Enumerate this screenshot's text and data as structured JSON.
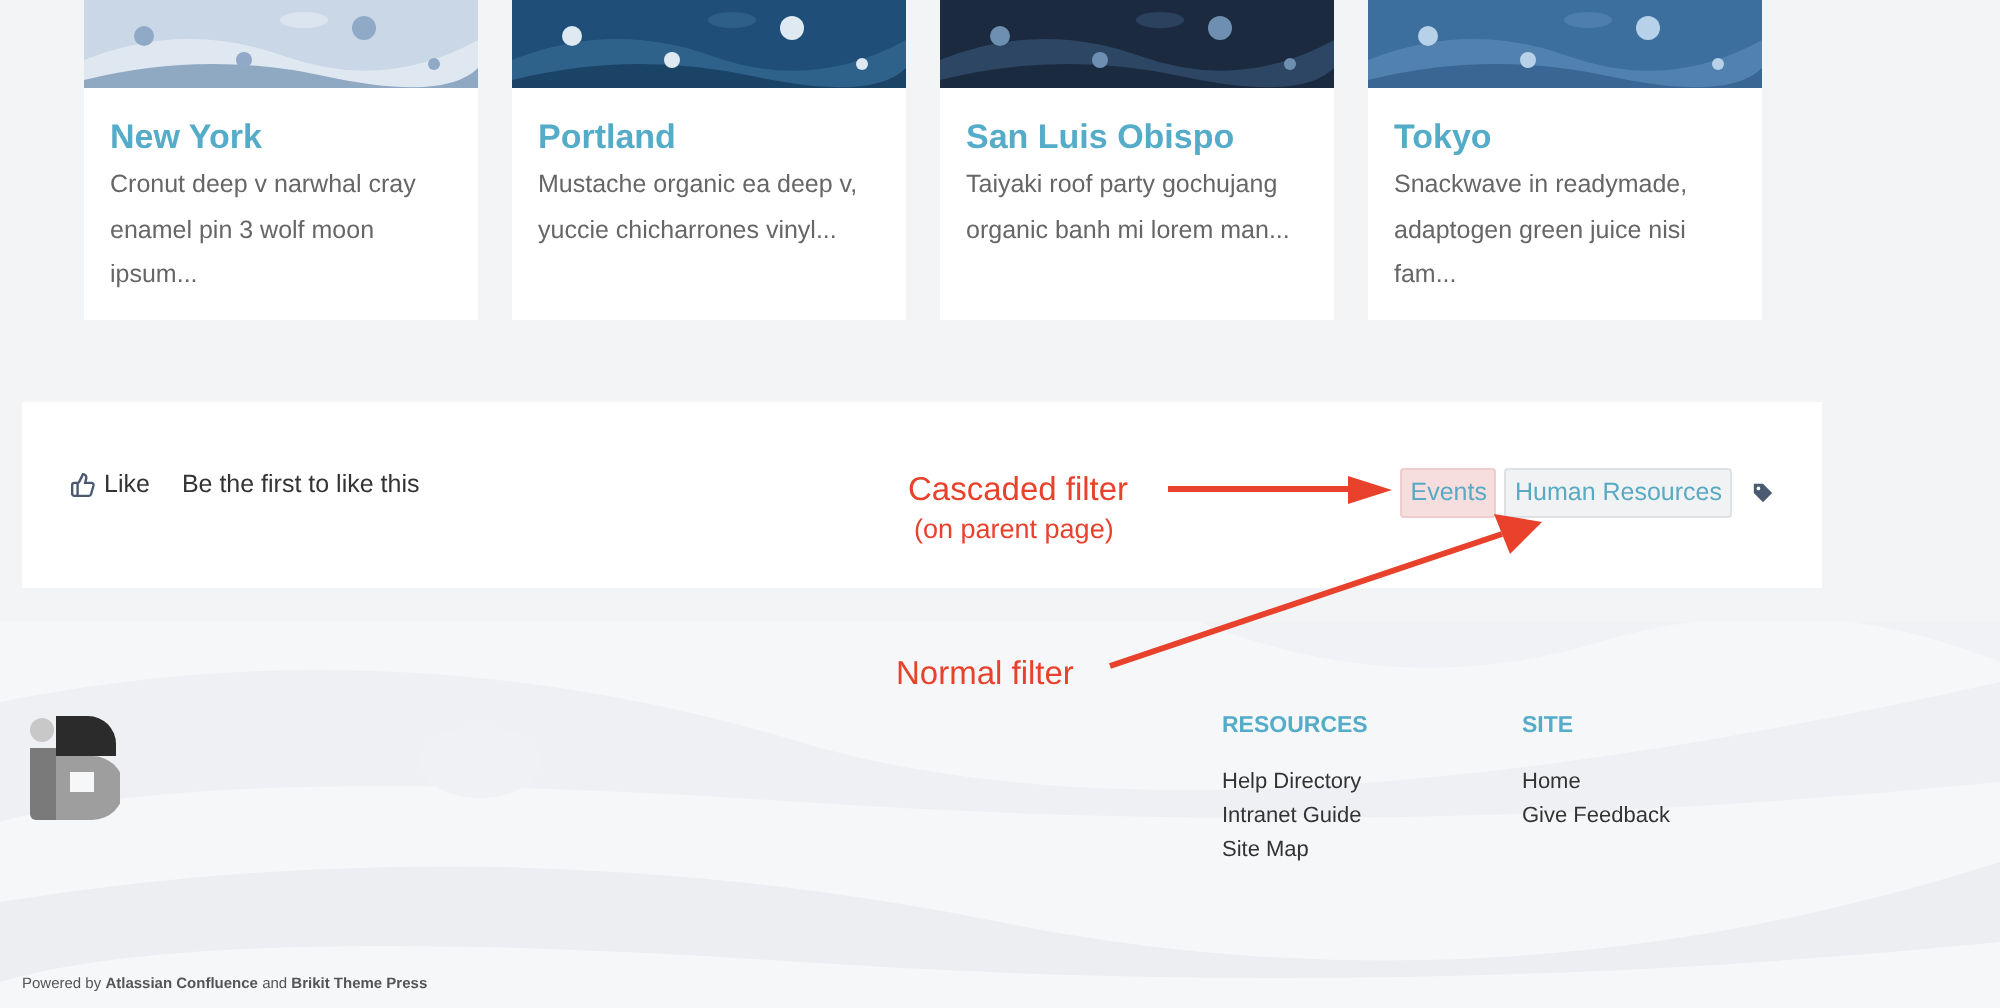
{
  "cards": [
    {
      "title": "New York",
      "text": "Cronut deep v narwhal cray enamel pin 3 wolf moon ipsum..."
    },
    {
      "title": "Portland",
      "text": "Mustache organic ea deep v, yuccie chicharrones vinyl..."
    },
    {
      "title": "San Luis Obispo",
      "text": "Taiyaki roof party gochujang organic banh mi lorem man..."
    },
    {
      "title": "Tokyo",
      "text": "Snackwave in readymade, adaptogen green juice nisi fam..."
    }
  ],
  "like_bar": {
    "like_button": "Like",
    "like_status": "Be the first to like this",
    "tags": [
      {
        "label": "Events",
        "kind": "cascaded"
      },
      {
        "label": "Human Resources",
        "kind": "normal"
      }
    ]
  },
  "annotations": [
    {
      "text": "Cascaded filter",
      "note": "(on parent page)"
    },
    {
      "text": "Normal filter"
    }
  ],
  "footer": {
    "columns": [
      {
        "heading": "RESOURCES",
        "links": [
          "Help Directory",
          "Intranet Guide",
          "Site Map"
        ]
      },
      {
        "heading": "SITE",
        "links": [
          "Home",
          "Give Feedback"
        ]
      }
    ],
    "powered_by": "Powered by **Atlassian Confluence** and **Brikit Theme Press**"
  }
}
